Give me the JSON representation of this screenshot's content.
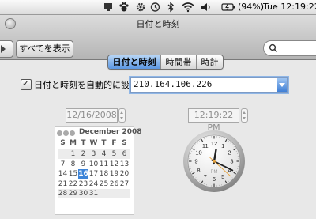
{
  "menubar": {
    "battery_percent": "(94%)",
    "clock": "Tue 12:19:22"
  },
  "window": {
    "title": "日付と時刻"
  },
  "toolbar": {
    "show_all_label": "すべてを表示"
  },
  "tabs": [
    {
      "label": "日付と時刻",
      "selected": true
    },
    {
      "label": "時間帯",
      "selected": false
    },
    {
      "label": "時計",
      "selected": false
    }
  ],
  "auto_set": {
    "checked": true,
    "label": "日付と時刻を自動的に設定：",
    "server": "210.164.106.226"
  },
  "date_field": "12/16/2008",
  "time_field": "12:19:22 PM",
  "calendar": {
    "month_label": "December 2008",
    "weekdays": [
      "S",
      "M",
      "T",
      "W",
      "T",
      "F",
      "S"
    ],
    "weeks": [
      [
        "",
        "1",
        "2",
        "3",
        "4",
        "5",
        "6"
      ],
      [
        "7",
        "8",
        "9",
        "10",
        "11",
        "12",
        "13"
      ],
      [
        "14",
        "15",
        "16",
        "17",
        "18",
        "19",
        "20"
      ],
      [
        "21",
        "22",
        "23",
        "24",
        "25",
        "26",
        "27"
      ],
      [
        "28",
        "29",
        "30",
        "31",
        "",
        "",
        ""
      ]
    ],
    "selected_day": "16"
  },
  "clock": {
    "numerals": [
      "12",
      "1",
      "2",
      "3",
      "4",
      "5",
      "6",
      "7",
      "8",
      "9",
      "10",
      "11"
    ],
    "meridiem": "PM",
    "hour": 12,
    "minute": 19,
    "second": 22
  },
  "colors": {
    "accent": "#3d84d8",
    "second_hand": "#e8a33a"
  }
}
